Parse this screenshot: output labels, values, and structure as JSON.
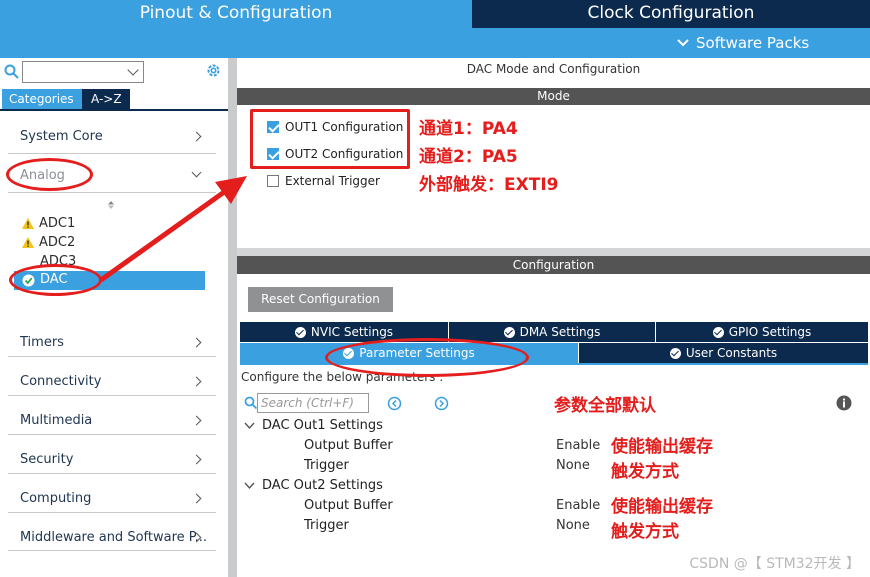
{
  "top_tabs": {
    "pinout": "Pinout & Configuration",
    "clock": "Clock Configuration"
  },
  "software_packs": "Software Packs",
  "sidebar": {
    "search_placeholder": "",
    "tabs": {
      "categories": "Categories",
      "az": "A->Z"
    },
    "categories": [
      "System Core",
      "Analog",
      "Timers",
      "Connectivity",
      "Multimedia",
      "Security",
      "Computing",
      "Middleware and Software P..."
    ],
    "analog_items": [
      "ADC1",
      "ADC2",
      "ADC3",
      "DAC"
    ]
  },
  "panel": {
    "title": "DAC Mode and Configuration",
    "mode_header": "Mode",
    "modes": [
      {
        "label": "OUT1 Configuration",
        "checked": true
      },
      {
        "label": "OUT2 Configuration",
        "checked": true
      },
      {
        "label": "External Trigger",
        "checked": false
      }
    ],
    "configuration_header": "Configuration",
    "reset_button": "Reset Configuration",
    "tabs_row1": [
      "NVIC Settings",
      "DMA Settings",
      "GPIO Settings"
    ],
    "tabs_row2": [
      "Parameter Settings",
      "User Constants"
    ],
    "configure_text": "Configure the below parameters :",
    "search_placeholder": "Search (Ctrl+F)",
    "tree": [
      {
        "group": "DAC Out1 Settings",
        "params": [
          {
            "name": "Output Buffer",
            "value": "Enable"
          },
          {
            "name": "Trigger",
            "value": "None"
          }
        ]
      },
      {
        "group": "DAC Out2 Settings",
        "params": [
          {
            "name": "Output Buffer",
            "value": "Enable"
          },
          {
            "name": "Trigger",
            "value": "None"
          }
        ]
      }
    ]
  },
  "annotations": {
    "ch1": "通道1：PA4",
    "ch2": "通道2：PA5",
    "ext": "外部触发：EXTI9",
    "defaults": "参数全部默认",
    "buffer1": "使能输出缓存",
    "trigger1": "触发方式",
    "buffer2": "使能输出缓存",
    "trigger2": "触发方式"
  },
  "watermark": "CSDN @【 STM32开发 】",
  "colors": {
    "accent": "#3ba0e0",
    "navy": "#0c2a4d",
    "annotation": "#e41d1d",
    "header_gray": "#545454"
  }
}
